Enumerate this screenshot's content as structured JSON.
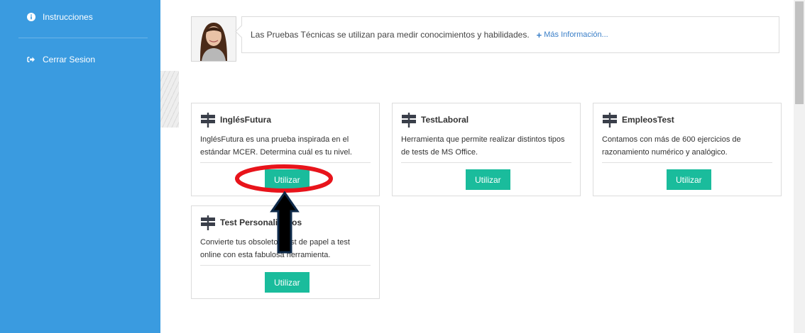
{
  "sidebar": {
    "items": [
      {
        "label": "Instrucciones",
        "icon": "info-circle-icon"
      },
      {
        "label": "Cerrar Sesion",
        "icon": "sign-out-icon"
      }
    ]
  },
  "intro": {
    "text": "Las Pruebas Técnicas se utilizan para medir conocimientos y habilidades.",
    "more_link": "Más Información..."
  },
  "cards": [
    {
      "title": "InglésFutura",
      "description": "InglésFutura es una prueba inspirada en el estándar MCER. Determina cuál es tu nivel.",
      "button": "Utilizar"
    },
    {
      "title": "TestLaboral",
      "description": "Herramienta que permite realizar distintos tipos de tests de MS Office.",
      "button": "Utilizar"
    },
    {
      "title": "EmpleosTest",
      "description": "Contamos con más de 600 ejercicios de razonamiento numérico y analógico.",
      "button": "Utilizar"
    },
    {
      "title": "Test Personalizados",
      "description": "Convierte tus obsoletos test de papel a test online con esta fabulosa herramienta.",
      "button": "Utilizar"
    }
  ],
  "colors": {
    "sidebar": "#3a9be0",
    "button": "#1abc9c",
    "link": "#3a7fc8",
    "annotation_ellipse": "#e8141b",
    "annotation_arrow": "#000000"
  }
}
